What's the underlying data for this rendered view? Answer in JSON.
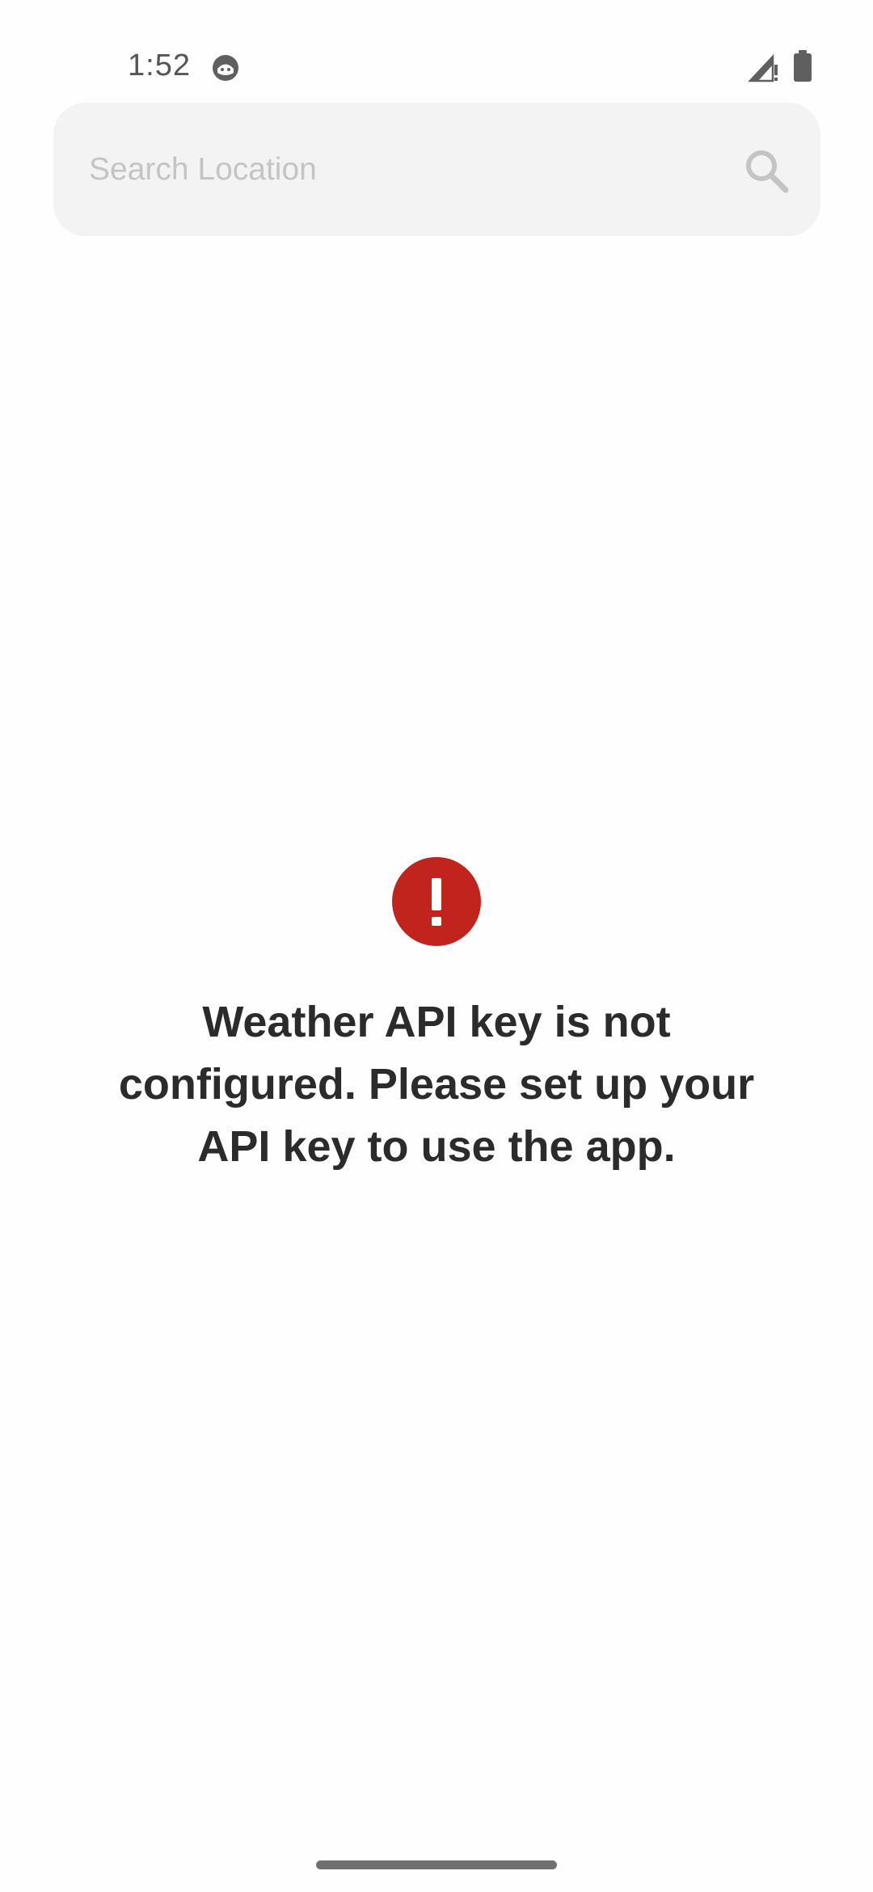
{
  "status_bar": {
    "time": "1:52",
    "app_icon": "android-debug-icon",
    "signal_icon": "signal-no-data-icon",
    "battery_icon": "battery-full-icon"
  },
  "search": {
    "value": "",
    "placeholder": "Search Location",
    "icon": "search-icon"
  },
  "error": {
    "icon": "error-alert-icon",
    "icon_color": "#c0241d",
    "message": "Weather API key is not configured. Please set up your API key to use the app."
  },
  "colors": {
    "background": "#fefefe",
    "search_background": "#f3f3f3",
    "text": "#2b2b2b",
    "placeholder": "#c4c4c4"
  }
}
